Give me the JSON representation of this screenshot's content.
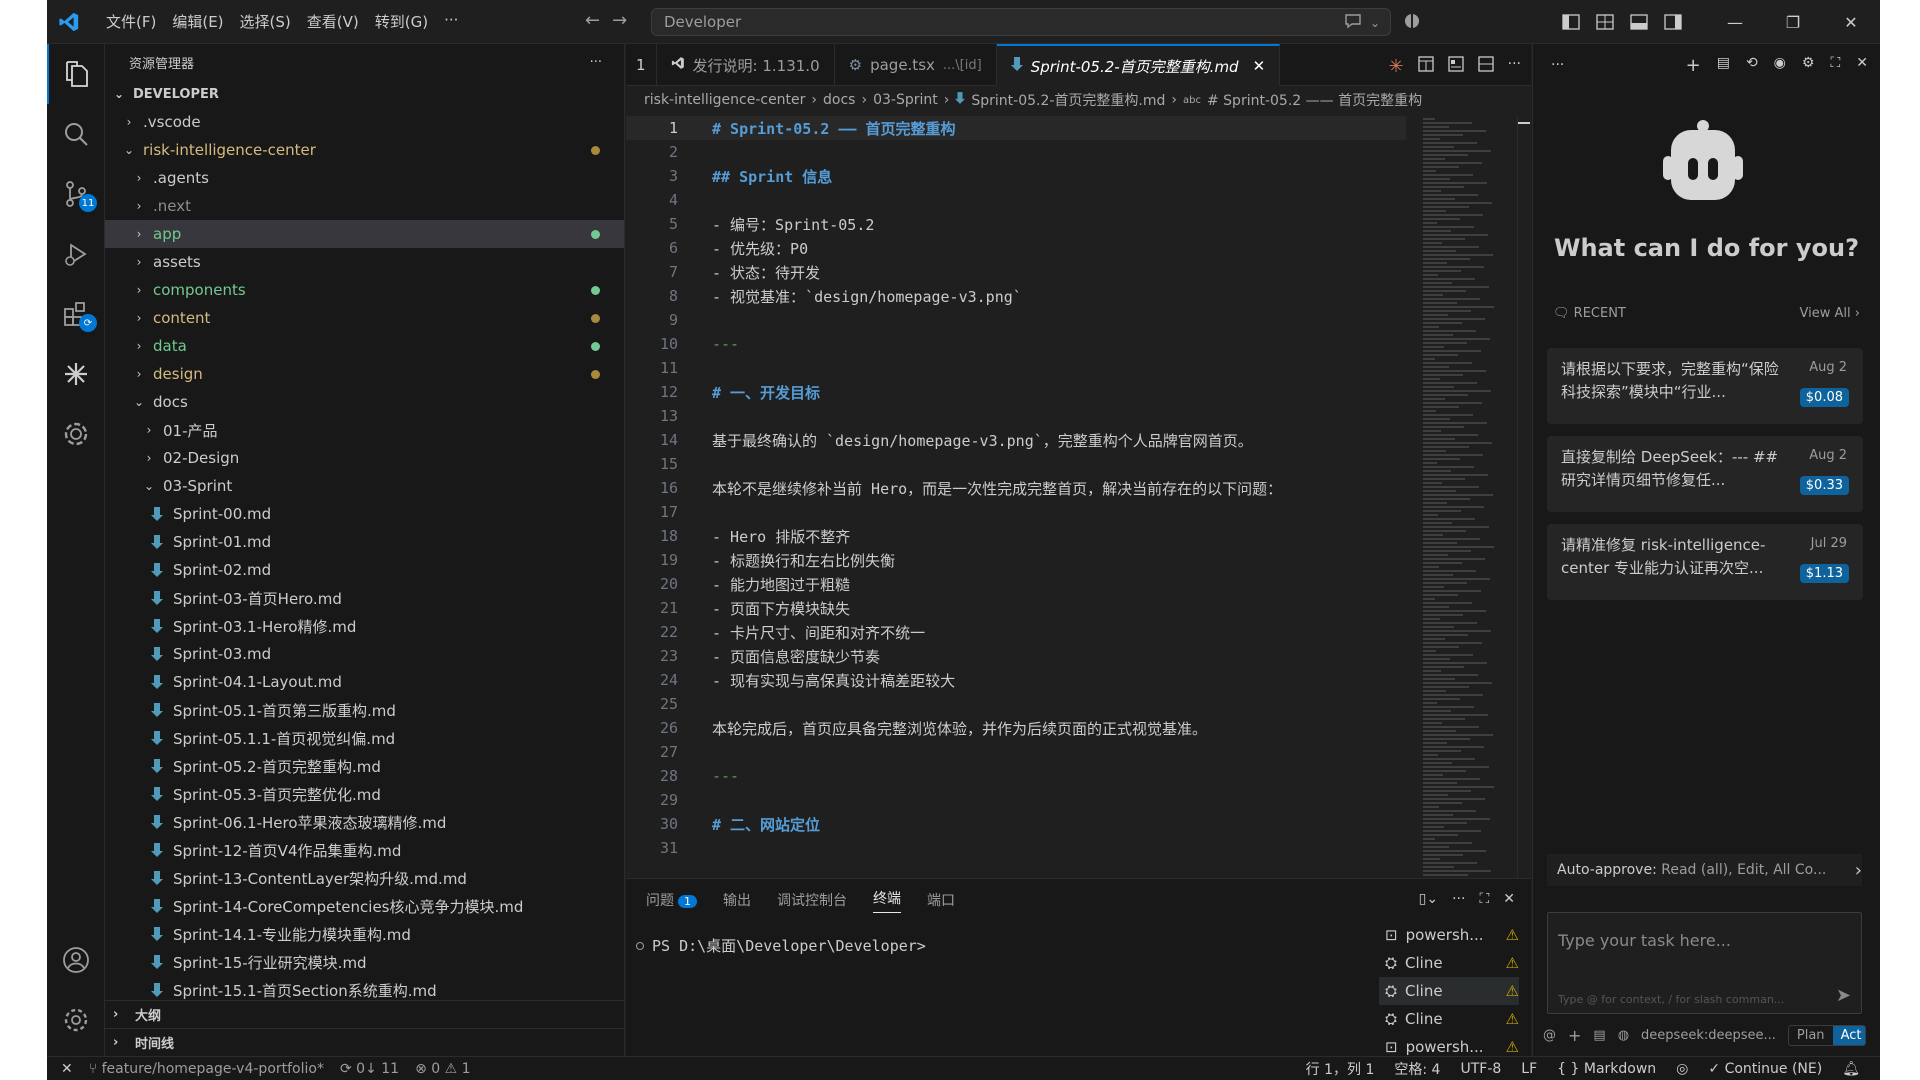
{
  "window": {
    "menu": [
      "文件(F)",
      "编辑(E)",
      "选择(S)",
      "查看(V)",
      "转到(G)",
      "···"
    ],
    "search_text": "Developer"
  },
  "activity": {
    "scm_badge": "11"
  },
  "sidebar": {
    "title": "资源管理器",
    "root": "DEVELOPER",
    "items": [
      {
        "label": ".vscode",
        "depth": 1,
        "kind": "folder",
        "open": false,
        "color": "#cccccc"
      },
      {
        "label": "risk-intelligence-center",
        "depth": 1,
        "kind": "folder",
        "open": true,
        "color": "#d7ba7d",
        "dot": "#a88a3f"
      },
      {
        "label": ".agents",
        "depth": 2,
        "kind": "folder",
        "open": false,
        "color": "#cccccc"
      },
      {
        "label": ".next",
        "depth": 2,
        "kind": "folder",
        "open": false,
        "color": "#8c8c8c"
      },
      {
        "label": "app",
        "depth": 2,
        "kind": "folder",
        "open": false,
        "color": "#73c991",
        "dot": "#73c991",
        "selected": true
      },
      {
        "label": "assets",
        "depth": 2,
        "kind": "folder",
        "open": false,
        "color": "#cccccc"
      },
      {
        "label": "components",
        "depth": 2,
        "kind": "folder",
        "open": false,
        "color": "#73c991",
        "dot": "#73c991"
      },
      {
        "label": "content",
        "depth": 2,
        "kind": "folder",
        "open": false,
        "color": "#d7ba7d",
        "dot": "#a88a3f"
      },
      {
        "label": "data",
        "depth": 2,
        "kind": "folder",
        "open": false,
        "color": "#73c991",
        "dot": "#73c991"
      },
      {
        "label": "design",
        "depth": 2,
        "kind": "folder",
        "open": false,
        "color": "#d7ba7d",
        "dot": "#a88a3f"
      },
      {
        "label": "docs",
        "depth": 2,
        "kind": "folder",
        "open": true,
        "color": "#cccccc"
      },
      {
        "label": "01-产品",
        "depth": 3,
        "kind": "folder",
        "open": false,
        "color": "#cccccc"
      },
      {
        "label": "02-Design",
        "depth": 3,
        "kind": "folder",
        "open": false,
        "color": "#cccccc"
      },
      {
        "label": "03-Sprint",
        "depth": 3,
        "kind": "folder",
        "open": true,
        "color": "#cccccc"
      },
      {
        "label": "Sprint-00.md",
        "depth": 4,
        "kind": "file",
        "color": "#cccccc"
      },
      {
        "label": "Sprint-01.md",
        "depth": 4,
        "kind": "file",
        "color": "#cccccc"
      },
      {
        "label": "Sprint-02.md",
        "depth": 4,
        "kind": "file",
        "color": "#cccccc"
      },
      {
        "label": "Sprint-03-首页Hero.md",
        "depth": 4,
        "kind": "file",
        "color": "#cccccc"
      },
      {
        "label": "Sprint-03.1-Hero精修.md",
        "depth": 4,
        "kind": "file",
        "color": "#cccccc"
      },
      {
        "label": "Sprint-03.md",
        "depth": 4,
        "kind": "file",
        "color": "#cccccc"
      },
      {
        "label": "Sprint-04.1-Layout.md",
        "depth": 4,
        "kind": "file",
        "color": "#cccccc"
      },
      {
        "label": "Sprint-05.1-首页第三版重构.md",
        "depth": 4,
        "kind": "file",
        "color": "#cccccc"
      },
      {
        "label": "Sprint-05.1.1-首页视觉纠偏.md",
        "depth": 4,
        "kind": "file",
        "color": "#cccccc"
      },
      {
        "label": "Sprint-05.2-首页完整重构.md",
        "depth": 4,
        "kind": "file",
        "color": "#cccccc"
      },
      {
        "label": "Sprint-05.3-首页完整优化.md",
        "depth": 4,
        "kind": "file",
        "color": "#cccccc"
      },
      {
        "label": "Sprint-06.1-Hero苹果液态玻璃精修.md",
        "depth": 4,
        "kind": "file",
        "color": "#cccccc"
      },
      {
        "label": "Sprint-12-首页V4作品集重构.md",
        "depth": 4,
        "kind": "file",
        "color": "#cccccc"
      },
      {
        "label": "Sprint-13-ContentLayer架构升级.md.md",
        "depth": 4,
        "kind": "file",
        "color": "#cccccc"
      },
      {
        "label": "Sprint-14-CoreCompetencies核心竞争力模块.md",
        "depth": 4,
        "kind": "file",
        "color": "#cccccc"
      },
      {
        "label": "Sprint-14.1-专业能力模块重构.md",
        "depth": 4,
        "kind": "file",
        "color": "#cccccc"
      },
      {
        "label": "Sprint-15-行业研究模块.md",
        "depth": 4,
        "kind": "file",
        "color": "#cccccc"
      },
      {
        "label": "Sprint-15.1-首页Section系统重构.md",
        "depth": 4,
        "kind": "file",
        "color": "#cccccc"
      }
    ],
    "outline": "大纲",
    "timeline": "时间线"
  },
  "editor": {
    "tab_overflow": "1",
    "tabs": [
      {
        "label": "发行说明: 1.131.0",
        "icon": "vscode-icon",
        "active": false
      },
      {
        "label": "page.tsx",
        "suffix": "...\\[id]",
        "icon": "gear-icon",
        "active": false
      },
      {
        "label": "Sprint-05.2-首页完整重构.md",
        "icon": "markdown-icon",
        "active": true
      }
    ],
    "breadcrumb": [
      "risk-intelligence-center",
      "docs",
      "03-Sprint",
      "Sprint-05.2-首页完整重构.md",
      "# Sprint-05.2 —— 首页完整重构"
    ],
    "lines": [
      {
        "n": "1",
        "text": "# Sprint-05.2 —— 首页完整重构",
        "kind": "h"
      },
      {
        "n": "2",
        "text": "",
        "kind": ""
      },
      {
        "n": "3",
        "text": "## Sprint 信息",
        "kind": "h"
      },
      {
        "n": "4",
        "text": "",
        "kind": ""
      },
      {
        "n": "5",
        "text": "- 编号：Sprint-05.2",
        "kind": ""
      },
      {
        "n": "6",
        "text": "- 优先级：P0",
        "kind": ""
      },
      {
        "n": "7",
        "text": "- 状态：待开发",
        "kind": ""
      },
      {
        "n": "8",
        "text": "- 视觉基准：`design/homepage-v3.png`",
        "kind": ""
      },
      {
        "n": "9",
        "text": "",
        "kind": ""
      },
      {
        "n": "10",
        "text": "---",
        "kind": "hr"
      },
      {
        "n": "11",
        "text": "",
        "kind": ""
      },
      {
        "n": "12",
        "text": "# 一、开发目标",
        "kind": "h"
      },
      {
        "n": "13",
        "text": "",
        "kind": ""
      },
      {
        "n": "14",
        "text": "基于最终确认的 `design/homepage-v3.png`，完整重构个人品牌官网首页。",
        "kind": ""
      },
      {
        "n": "15",
        "text": "",
        "kind": ""
      },
      {
        "n": "16",
        "text": "本轮不是继续修补当前 Hero，而是一次性完成完整首页，解决当前存在的以下问题：",
        "kind": ""
      },
      {
        "n": "17",
        "text": "",
        "kind": ""
      },
      {
        "n": "18",
        "text": "- Hero 排版不整齐",
        "kind": ""
      },
      {
        "n": "19",
        "text": "- 标题换行和左右比例失衡",
        "kind": ""
      },
      {
        "n": "20",
        "text": "- 能力地图过于粗糙",
        "kind": ""
      },
      {
        "n": "21",
        "text": "- 页面下方模块缺失",
        "kind": ""
      },
      {
        "n": "22",
        "text": "- 卡片尺寸、间距和对齐不统一",
        "kind": ""
      },
      {
        "n": "23",
        "text": "- 页面信息密度缺少节奏",
        "kind": ""
      },
      {
        "n": "24",
        "text": "- 现有实现与高保真设计稿差距较大",
        "kind": ""
      },
      {
        "n": "25",
        "text": "",
        "kind": ""
      },
      {
        "n": "26",
        "text": "本轮完成后，首页应具备完整浏览体验，并作为后续页面的正式视觉基准。",
        "kind": ""
      },
      {
        "n": "27",
        "text": "",
        "kind": ""
      },
      {
        "n": "28",
        "text": "---",
        "kind": "hr"
      },
      {
        "n": "29",
        "text": "",
        "kind": ""
      },
      {
        "n": "30",
        "text": "# 二、网站定位",
        "kind": "h"
      },
      {
        "n": "31",
        "text": "",
        "kind": ""
      }
    ]
  },
  "panel": {
    "tabs": [
      {
        "label": "问题",
        "badge": "1"
      },
      {
        "label": "输出"
      },
      {
        "label": "调试控制台"
      },
      {
        "label": "终端",
        "active": true
      },
      {
        "label": "端口"
      }
    ],
    "prompt": "PS D:\\桌面\\Developer\\Developer>",
    "terminals": [
      {
        "label": "powersh...",
        "icon": "terminal-icon"
      },
      {
        "label": "Cline",
        "icon": "robot-icon"
      },
      {
        "label": "Cline",
        "icon": "robot-icon",
        "active": true
      },
      {
        "label": "Cline",
        "icon": "robot-icon"
      },
      {
        "label": "powersh...",
        "icon": "terminal-icon"
      }
    ]
  },
  "chat": {
    "title": "What can I do for you?",
    "recent_label": "RECENT",
    "view_all": "View All",
    "tasks": [
      {
        "text": "请根据以下要求，完整重构“保险科技探索”模块中“行业...",
        "date": "Aug 2",
        "cost": "$0.08"
      },
      {
        "text": "直接复制给 DeepSeek：--- ## 研究详情页细节修复任...",
        "date": "Aug 2",
        "cost": "$0.33"
      },
      {
        "text": "请精准修复 risk-intelligence-center 专业能力认证再次空...",
        "date": "Jul 29",
        "cost": "$1.13"
      }
    ],
    "auto_approve_label": "Auto-approve:",
    "auto_approve_value": "Read (all), Edit, All Co...",
    "input_placeholder": "Type your task here...",
    "input_hint": "Type @ for context, / for slash comman...",
    "model": "deepseek:deepsee...",
    "plan": "Plan",
    "act": "Act"
  },
  "status": {
    "branch": "feature/homepage-v4-portfolio*",
    "sync": "0↓ 11",
    "errors": "0",
    "warnings": "1",
    "position": "行 1，列 1",
    "spaces": "空格: 4",
    "encoding": "UTF-8",
    "eol": "LF",
    "language": "Markdown",
    "continue": "Continue (NE)"
  }
}
